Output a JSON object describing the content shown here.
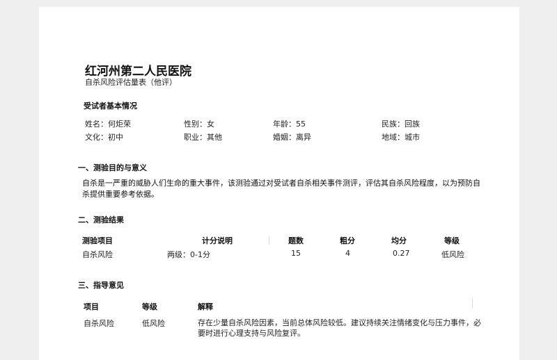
{
  "header": {
    "hospital": "红河州第二人民医院",
    "form_title": "自杀风险评估量表（他评）"
  },
  "basic_info": {
    "title": "受试者基本情况",
    "name": "姓名：何炬荣",
    "gender": "性别：女",
    "age": "年龄：55",
    "ethnicity": "民族：回族",
    "education": "文化：初中",
    "occupation": "职业：其他",
    "marriage": "婚姻：离异",
    "region": "地域：城市"
  },
  "section1": {
    "title": "一、测验目的与意义",
    "text": "自杀是一严重的威胁人们生命的重大事件，该测验通过对受试者自杀相关事件测评，评估其自杀风险程度，以为预防自杀提供重要参考依据。"
  },
  "section2": {
    "title": "二、测验结果",
    "columns": [
      "测验项目",
      "计分说明",
      "题数",
      "粗分",
      "均分",
      "等级"
    ],
    "row": [
      "自杀风险",
      "两级：0-1分",
      "15",
      "4",
      "0.27",
      "低风险"
    ]
  },
  "section3": {
    "title": "三、指导意见",
    "columns": [
      "项目",
      "等级",
      "解释"
    ],
    "row": {
      "item": "自杀风险",
      "level": "低风险",
      "explain": "存在少量自杀风险因素，当前总体风险较低。建议持续关注情绪变化与压力事件，必要时进行心理支持与风险复评。"
    }
  }
}
